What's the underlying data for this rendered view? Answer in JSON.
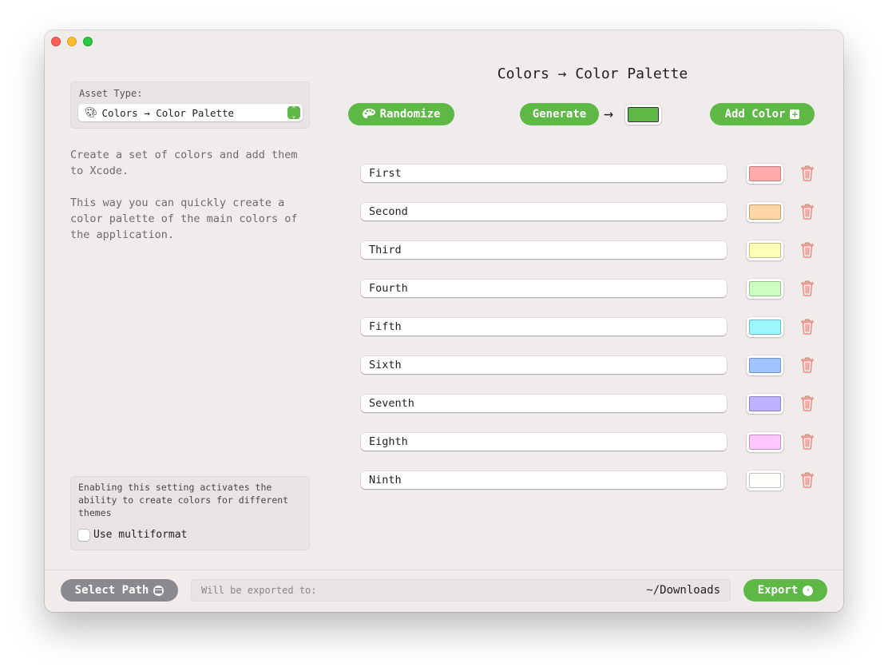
{
  "window": {
    "title": ""
  },
  "sidebar": {
    "asset_type_label": "Asset Type:",
    "asset_type_value": "Colors → Color Palette",
    "asset_type_icon": "palette-icon",
    "description": "Create a set of colors and add them\nto Xcode.\n\nThis way you can quickly create a\ncolor palette of the main colors of\nthe application.",
    "multiformat": {
      "description": "Enabling this setting activates the ability to create colors for different themes",
      "checkbox_label": "Use multiformat",
      "checked": false
    }
  },
  "main": {
    "title": "Colors → Color Palette",
    "randomize_label": "Randomize",
    "generate_label": "Generate",
    "generate_arrow": "→",
    "generated_color": "#5db845",
    "add_color_label": "Add Color",
    "colors": [
      {
        "name": "First",
        "hex": "#ffabab"
      },
      {
        "name": "Second",
        "hex": "#ffd6a5"
      },
      {
        "name": "Third",
        "hex": "#fdffb6"
      },
      {
        "name": "Fourth",
        "hex": "#caffbf"
      },
      {
        "name": "Fifth",
        "hex": "#9bf6ff"
      },
      {
        "name": "Sixth",
        "hex": "#a0c4ff"
      },
      {
        "name": "Seventh",
        "hex": "#bdb2ff"
      },
      {
        "name": "Eighth",
        "hex": "#ffc6ff"
      },
      {
        "name": "Ninth",
        "hex": "#fffffc"
      }
    ]
  },
  "footer": {
    "select_path_label": "Select Path",
    "export_hint": "Will be exported to:",
    "export_path": "~/Downloads",
    "export_label": "Export"
  },
  "colors": {
    "accent": "#5db845",
    "danger": "#f0776d",
    "neutral_button": "#8a8a8e"
  }
}
